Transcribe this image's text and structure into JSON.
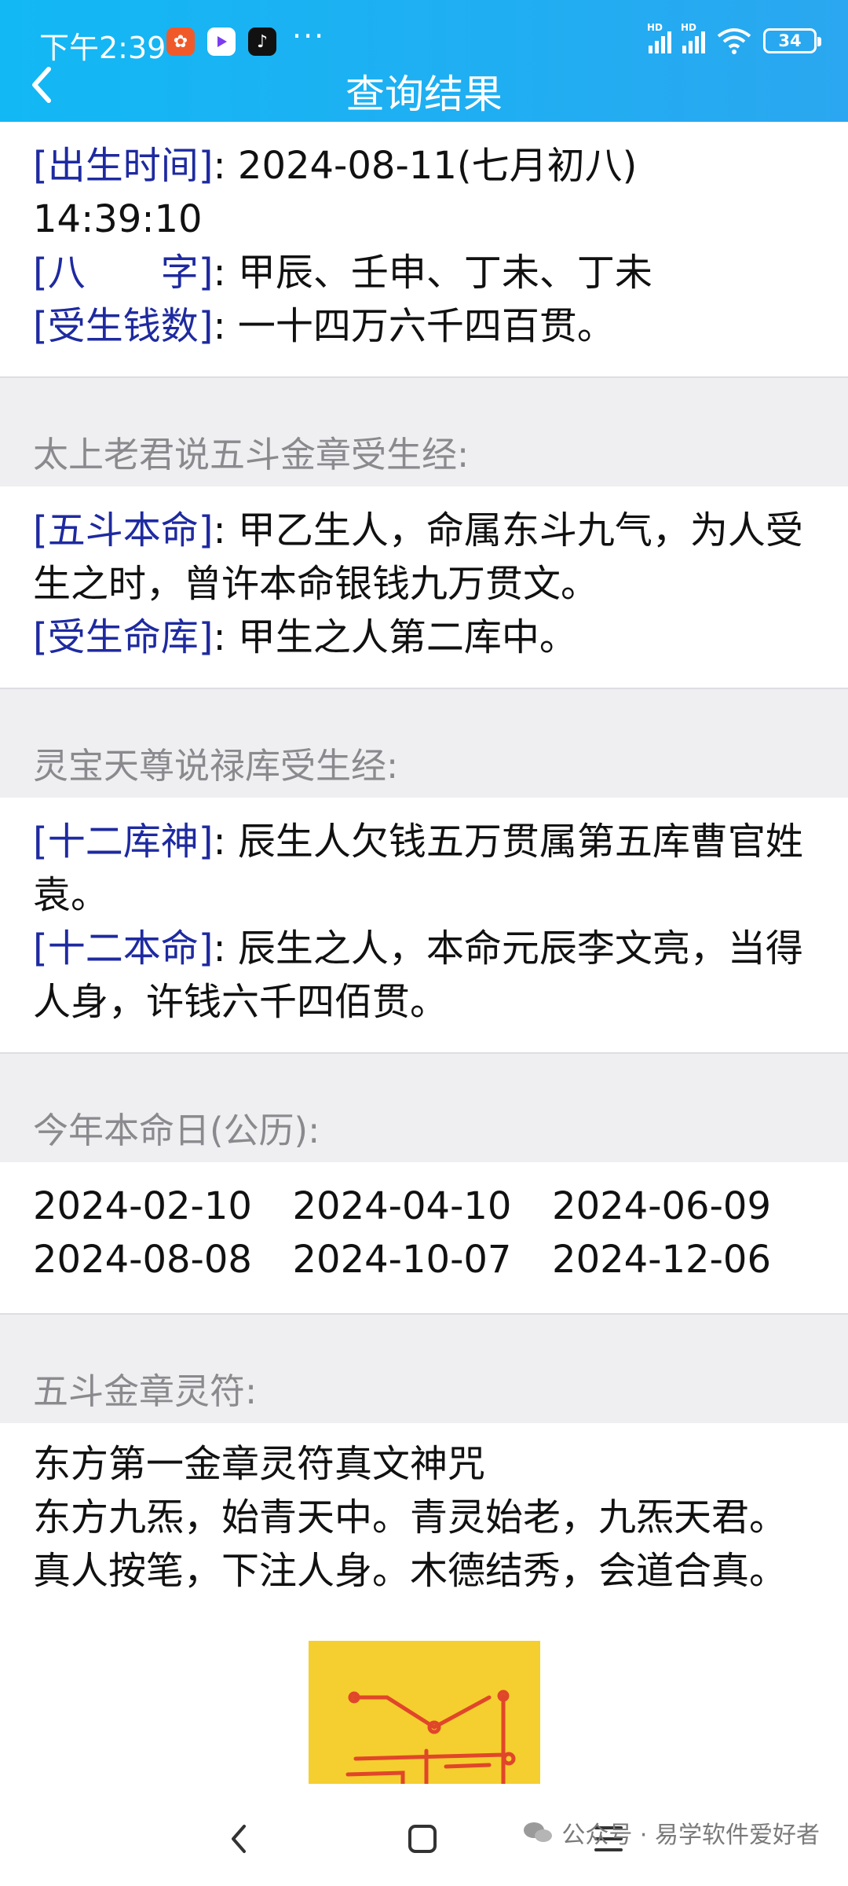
{
  "status": {
    "time": "下午2:39",
    "dots": "···",
    "signal1_label": "HD",
    "signal2_label": "HD",
    "battery": "34"
  },
  "header": {
    "title": "查询结果"
  },
  "info": [
    {
      "tag": "[出生时间]",
      "text": ": 2024-08-11(七月初八) 14:39:10"
    },
    {
      "tag": "[八　　字]",
      "text": ": 甲辰、壬申、丁未、丁未"
    },
    {
      "tag": "[受生钱数]",
      "text": ": 一十四万六千四百贯。"
    }
  ],
  "sections": {
    "s1_title": "太上老君说五斗金章受生经:",
    "s1_rows": [
      {
        "tag": "[五斗本命]",
        "text": ": 甲乙生人，命属东斗九气，为人受生之时，曾许本命银钱九万贯文。"
      },
      {
        "tag": "[受生命库]",
        "text": ": 甲生之人第二库中。"
      }
    ],
    "s2_title": "灵宝天尊说禄库受生经:",
    "s2_rows": [
      {
        "tag": "[十二库神]",
        "text": ": 辰生人欠钱五万贯属第五库曹官姓袁。"
      },
      {
        "tag": "[十二本命]",
        "text": ": 辰生之人，本命元辰李文亮，当得人身，许钱六千四佰贯。"
      }
    ],
    "s3_title": "今年本命日(公历):",
    "s3_dates": [
      "2024-02-10",
      "2024-04-10",
      "2024-06-09",
      "2024-08-08",
      "2024-10-07",
      "2024-12-06"
    ],
    "s4_title": "五斗金章灵符:",
    "s4_lines": [
      "东方第一金章灵符真文神咒",
      "东方九炁，始青天中。青灵始老，九炁天君。",
      "真人按笔，下注人身。木德结秀，会道合真。"
    ]
  },
  "watermark": "公众号 · 易学软件爱好者",
  "colors": {
    "header": "#12b8f4",
    "tag": "#1e2aa0",
    "talisman_bg": "#f5cf2f",
    "talisman_ink": "#e0462a"
  }
}
